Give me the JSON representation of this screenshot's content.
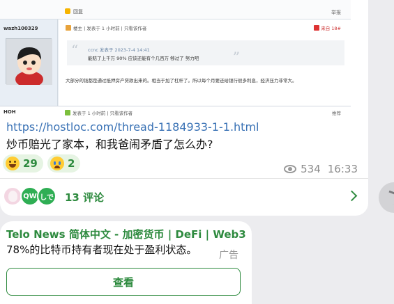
{
  "forum_screenshot": {
    "reply_label": "回复",
    "report_label": "举报",
    "username": "wazh100329",
    "post_meta": "楼主 | 发表于 1 小时前 | 只看该作者",
    "floor_label": "来自 18#",
    "quote_meta": "ccnc 发表于 2023-7-4 14:41",
    "quote_text": "能赔了上千万 90% 应该还能有个几百万 够过了 努力吧",
    "body_text": "大部分的钱都是通过抵押房产贷款出来的。相当于加了杠杆了。所以每个月要还给银行很多利息，经济压力非常大。",
    "next_username": "HOH",
    "next_meta": "发表于 1 小时前 | 只看该作者",
    "next_right": "推荐"
  },
  "message": {
    "link": "https://hostloc.com/thread-1184933-1-1.html",
    "title": "炒币赔光了家本，和我爸闹矛盾了怎么办?",
    "reactions": [
      {
        "emoji": "grinning-face",
        "count": "29"
      },
      {
        "emoji": "crying-face",
        "count": "2"
      }
    ],
    "views": "534",
    "time": "16:33",
    "commenters": [
      {
        "initials": ""
      },
      {
        "initials": "QW"
      },
      {
        "initials": "しで"
      }
    ],
    "comments_label": "13 评论"
  },
  "ad": {
    "title": "Telo News 简体中文 - 加密货币 | DeFi | Web3",
    "text": "78%的比特币持有者现在处于盈利状态。",
    "label": "广告",
    "button": "查看"
  },
  "colors": {
    "accent": "#2d8a3e",
    "link": "#3a72b5",
    "muted": "#8b8b8b"
  }
}
